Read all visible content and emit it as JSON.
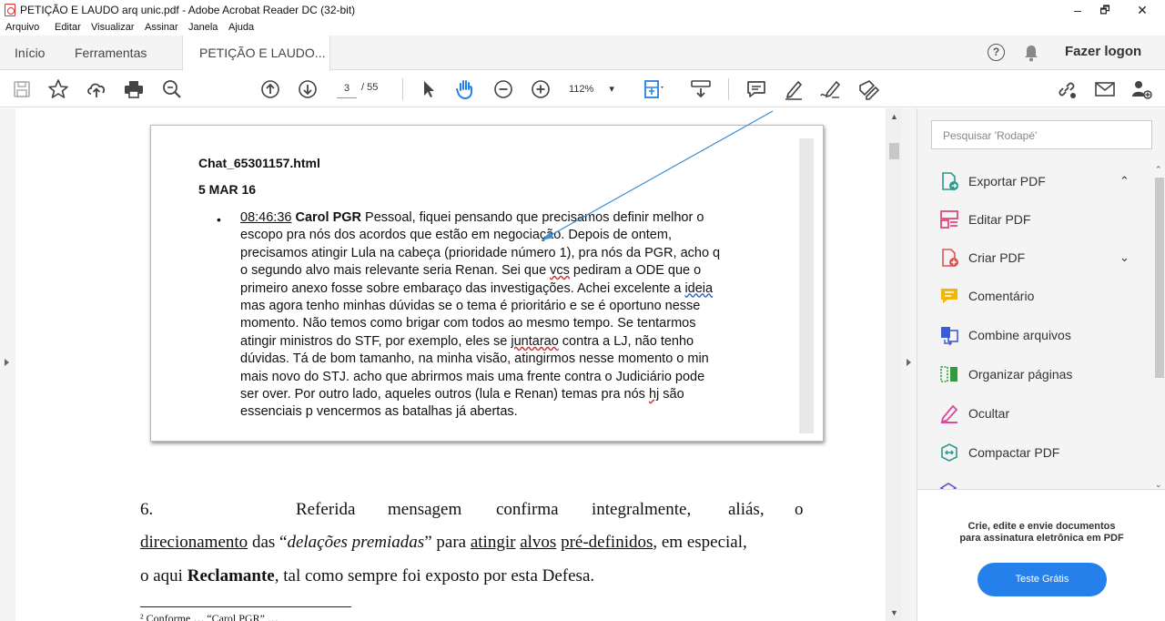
{
  "window": {
    "title": "PETIÇÃO E LAUDO arq unic.pdf - Adobe Acrobat Reader DC (32-bit)",
    "minimize": "–",
    "restore": "🗗",
    "close": "✕"
  },
  "menu": [
    "Arquivo",
    "Editar",
    "Visualizar",
    "Assinar",
    "Janela",
    "Ajuda"
  ],
  "tabs": {
    "home": "Início",
    "tools": "Ferramentas",
    "doc": "PETIÇÃO E LAUDO...",
    "doc_close": "✕"
  },
  "header": {
    "help": "?",
    "login": "Fazer logon"
  },
  "toolbar": {
    "page_current": "3",
    "page_total": "/ 55",
    "zoom": "112%",
    "zoom_arrow": "▾"
  },
  "search": {
    "placeholder": "Pesquisar 'Rodapé'"
  },
  "tools": [
    {
      "label": "Exportar PDF",
      "icon": "export-pdf-icon",
      "color": "#2b9a8e",
      "chevron": "⌃"
    },
    {
      "label": "Editar PDF",
      "icon": "edit-pdf-icon",
      "color": "#e5457a"
    },
    {
      "label": "Criar PDF",
      "icon": "create-pdf-icon",
      "color": "#e05353",
      "chevron": "⌄"
    },
    {
      "label": "Comentário",
      "icon": "comment-icon",
      "color": "#f2b705"
    },
    {
      "label": "Combine arquivos",
      "icon": "combine-files-icon",
      "color": "#3c5bd6"
    },
    {
      "label": "Organizar páginas",
      "icon": "organize-pages-icon",
      "color": "#2e9b3c"
    },
    {
      "label": "Ocultar",
      "icon": "redact-icon",
      "color": "#d94aa0"
    },
    {
      "label": "Compactar PDF",
      "icon": "compress-pdf-icon",
      "color": "#2b9a8e"
    }
  ],
  "promo": {
    "line1": "Crie, edite e envie documentos",
    "line2": "para assinatura eletrônica em PDF",
    "button": "Teste Grátis"
  },
  "document": {
    "chat_title": "Chat_65301157.html",
    "chat_date": "5 MAR 16",
    "bullet": "•",
    "time": "08:46:36",
    "author": "Carol PGR",
    "msg_1": " Pessoal, fiquei pensando que precisamos definir melhor o escopo pra nós dos acordos que estão em negociação. Depois de ontem, precisamos atingir Lula na cabeça (prioridade número 1), pra nós da PGR, acho q o segundo alvo mais relevante seria Renan. Sei que ",
    "w_vcs": "vcs",
    "msg_2": " pediram a ODE que o primeiro anexo fosse sobre embaraço das investigações. Achei excelente a ",
    "w_ideia": "ideia",
    "msg_3": " mas agora tenho minhas dúvidas se o tema é prioritário e se é oportuno nesse momento. Não temos como brigar com todos ao mesmo tempo. Se tentarmos atingir ministros do STF, por exemplo, eles se ",
    "w_juntarao": "juntarao",
    "msg_4": " contra a LJ, não tenho dúvidas. Tá de bom tamanho, na minha visão, atingirmos nesse momento o min mais novo do STJ. acho que abrirmos mais uma frente contra o Judiciário pode ser over. Por outro lado, aqueles outros (lula e Renan) temas pra nós ",
    "w_hj": "hj",
    "msg_5": " são essenciais p vencermos as batalhas já abertas.",
    "p_num": "6.",
    "p1": "Referida",
    "p2": "mensagem",
    "p3": "confirma",
    "p4": "integralmente,",
    "p5": "aliás,",
    "p6": "o",
    "l2_a": "direcionamento",
    "l2_b": " das “",
    "l2_c": "delações premiadas",
    "l2_d": "” para ",
    "l2_e": "atingir",
    "l2_f": " ",
    "l2_g": "alvos",
    "l2_h": " ",
    "l2_i": "pré-definidos",
    "l2_j": ", em especial,",
    "l3_a": "o aqui ",
    "l3_b": "Reclamante",
    "l3_c": ", tal como sempre foi exposto por esta Defesa.",
    "footnote": "² Conforme … “Carol PGR” …"
  }
}
